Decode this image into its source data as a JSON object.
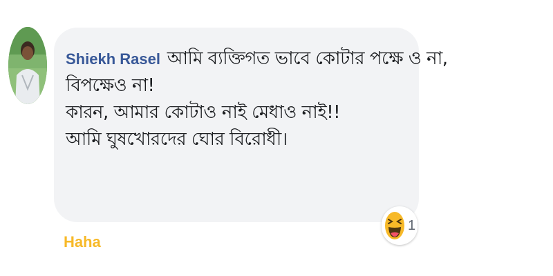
{
  "comment": {
    "author": "Shiekh Rasel",
    "lines": [
      "আমি ব্যক্তিগত ভাবে কোটার পক্ষে ও না,",
      "বিপক্ষেও না!",
      "কারন, আমার কোটাও নাই মেধাও নাই!!",
      "আমি ঘুষখোরদের ঘোর বিরোধী।"
    ]
  },
  "reaction": {
    "icon": "haha-emoji-icon",
    "count": "1",
    "color": "#f7b928"
  },
  "actions": {
    "reaction_label": "Haha"
  },
  "colors": {
    "bubble_bg": "#f2f3f5",
    "author_link": "#385898",
    "haha_accent": "#f7b928"
  }
}
